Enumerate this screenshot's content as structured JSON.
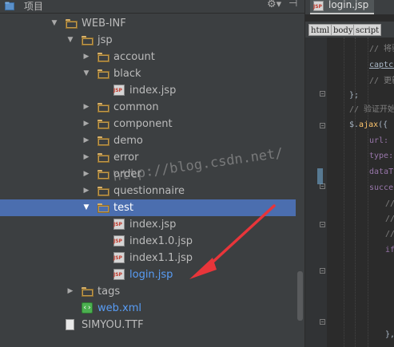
{
  "panel": {
    "title": "项目",
    "gear_icon": "gear-icon",
    "hide_icon": "hide-panel-icon"
  },
  "tree": [
    {
      "label": "WEB-INF",
      "kind": "folder",
      "arrow": "down"
    },
    {
      "label": "jsp",
      "kind": "folder",
      "arrow": "down"
    },
    {
      "label": "account",
      "kind": "folder",
      "arrow": "right"
    },
    {
      "label": "black",
      "kind": "folder",
      "arrow": "down"
    },
    {
      "label": "index.jsp",
      "kind": "jsp"
    },
    {
      "label": "common",
      "kind": "folder",
      "arrow": "right"
    },
    {
      "label": "component",
      "kind": "folder",
      "arrow": "right"
    },
    {
      "label": "demo",
      "kind": "folder",
      "arrow": "right"
    },
    {
      "label": "error",
      "kind": "folder",
      "arrow": "right"
    },
    {
      "label": "order",
      "kind": "folder",
      "arrow": "right"
    },
    {
      "label": "questionnaire",
      "kind": "folder",
      "arrow": "right"
    },
    {
      "label": "test",
      "kind": "folder",
      "arrow": "down",
      "selected": true
    },
    {
      "label": "index.jsp",
      "kind": "jsp"
    },
    {
      "label": "index1.0.jsp",
      "kind": "jsp"
    },
    {
      "label": "index1.1.jsp",
      "kind": "jsp"
    },
    {
      "label": "login.jsp",
      "kind": "jsp",
      "highlight": true
    },
    {
      "label": "tags",
      "kind": "folder",
      "arrow": "right"
    },
    {
      "label": "web.xml",
      "kind": "xml"
    },
    {
      "label": "SIMYOU.TTF",
      "kind": "ttf"
    }
  ],
  "editor": {
    "tab_label": "login.jsp",
    "breadcrumbs": [
      "html",
      "body",
      "script"
    ],
    "code": [
      {
        "parts": [
          {
            "t": "// 将验",
            "c": "c-com"
          }
        ]
      },
      {
        "parts": [
          {
            "t": "captch",
            "c": "c-und"
          }
        ]
      },
      {
        "parts": [
          {
            "t": "// 更新",
            "c": "c-com"
          }
        ]
      },
      {
        "parts": [
          {
            "t": "};",
            "c": "c-pl"
          }
        ]
      },
      {
        "parts": [
          {
            "t": "// 验证开始",
            "c": "c-com"
          }
        ]
      },
      {
        "parts": [
          {
            "t": "$.",
            "c": "c-pl"
          },
          {
            "t": "ajax",
            "c": "c-fn"
          },
          {
            "t": "({",
            "c": "c-pl"
          }
        ]
      },
      {
        "parts": [
          {
            "t": "url: ",
            "c": "c-key"
          }
        ]
      },
      {
        "parts": [
          {
            "t": "type:",
            "c": "c-key"
          }
        ]
      },
      {
        "parts": [
          {
            "t": "dataTy",
            "c": "c-key"
          }
        ]
      },
      {
        "parts": [
          {
            "t": "succes",
            "c": "c-key"
          }
        ]
      },
      {
        "parts": [
          {
            "t": "//",
            "c": "c-com"
          }
        ]
      },
      {
        "parts": [
          {
            "t": "//",
            "c": "c-com"
          }
        ]
      },
      {
        "parts": [
          {
            "t": "//",
            "c": "c-com"
          }
        ]
      },
      {
        "parts": [
          {
            "t": "if",
            "c": "c-key"
          }
        ]
      },
      {
        "parts": [
          {
            "t": "",
            "c": "c-pl"
          }
        ]
      },
      {
        "parts": [
          {
            "t": "",
            "c": "c-pl"
          }
        ]
      },
      {
        "parts": [
          {
            "t": "",
            "c": "c-pl"
          }
        ]
      },
      {
        "parts": [
          {
            "t": "",
            "c": "c-pl"
          }
        ]
      },
      {
        "parts": [
          {
            "t": "},",
            "c": "c-pl"
          }
        ]
      }
    ]
  },
  "watermark": "http://blog.csdn.net/",
  "colors": {
    "selection": "#4b6eaf",
    "annotation_arrow": "#e8353a",
    "link_blue": "#589df6"
  }
}
